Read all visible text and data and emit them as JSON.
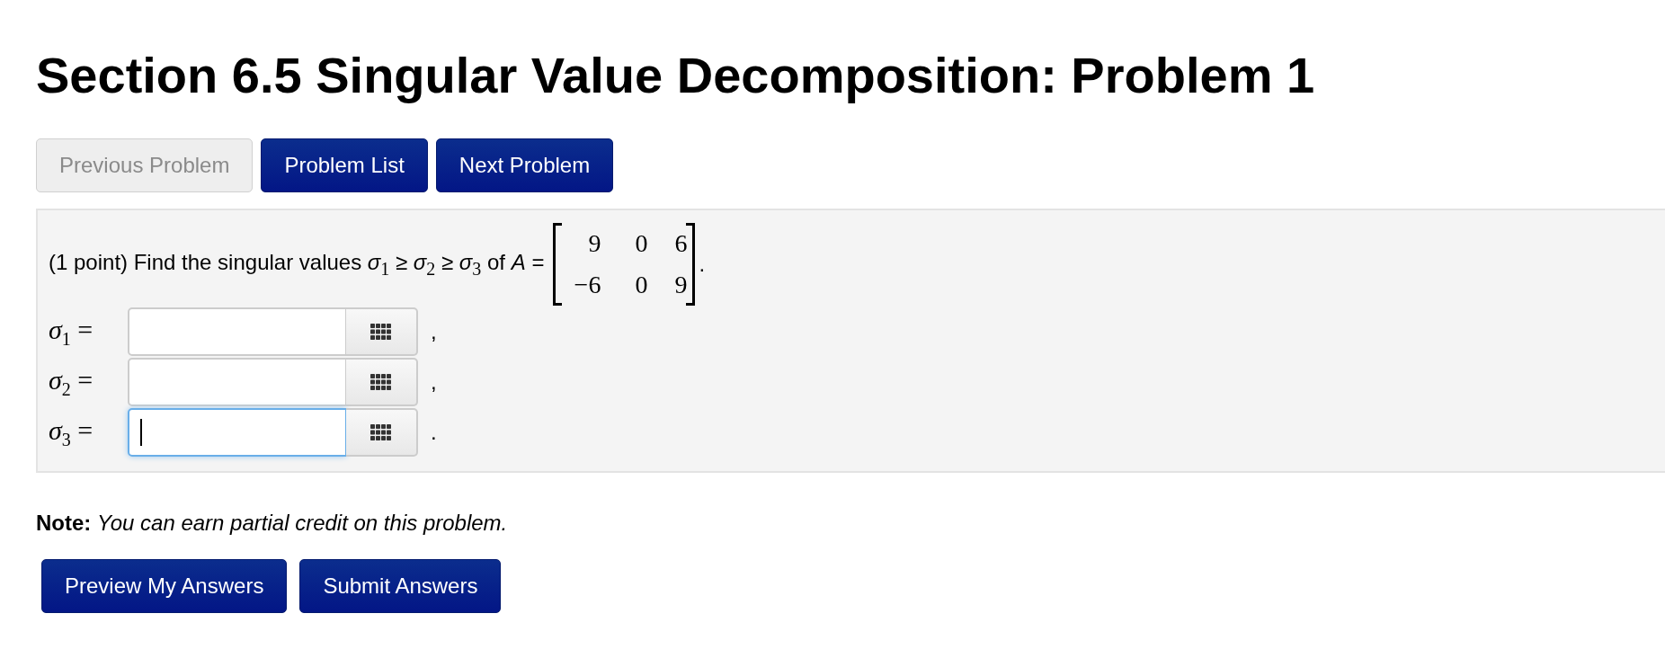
{
  "title": "Section 6.5 Singular Value Decomposition: Problem 1",
  "nav_buttons": [
    {
      "label": "Previous Problem",
      "disabled": true
    },
    {
      "label": "Problem List",
      "disabled": false
    },
    {
      "label": "Next Problem",
      "disabled": false
    }
  ],
  "problem": {
    "statement": "(1 point) Find the singular values *σ*$_{1}$ ≥ *σ*$_{2}$ ≥ *σ*$_{3}$ of *A* =",
    "matrix": [
      [
        "9",
        "0",
        "6"
      ],
      [
        "−6",
        "0",
        "9"
      ]
    ],
    "matrix_end": ".",
    "answers": [
      {
        "label": "σ",
        "index": "1",
        "equals": "=",
        "focused": false,
        "suffix": ","
      },
      {
        "label": "σ",
        "index": "2",
        "equals": "=",
        "focused": false,
        "suffix": ","
      },
      {
        "label": "σ",
        "index": "3",
        "equals": "=",
        "focused": true,
        "suffix": "."
      }
    ]
  },
  "note": "**Note:** *You can earn partial credit on this problem.*",
  "submit_buttons": [
    {
      "label": "Preview My Answers"
    },
    {
      "label": "Submit Answers"
    }
  ]
}
